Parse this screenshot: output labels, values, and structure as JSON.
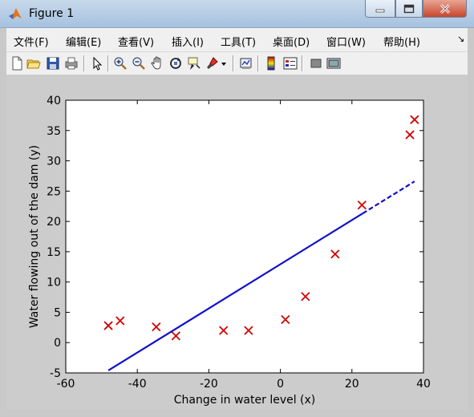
{
  "window": {
    "title": "Figure 1"
  },
  "menu": [
    "文件(F)",
    "编辑(E)",
    "查看(V)",
    "插入(I)",
    "工具(T)",
    "桌面(D)",
    "窗口(W)",
    "帮助(H)"
  ],
  "toolbar": [
    "new-figure",
    "open-file",
    "save",
    "print",
    "pointer",
    "zoom-in",
    "zoom-out",
    "pan",
    "rotate-3d",
    "data-cursor",
    "brush",
    "link",
    "insert-colorbar",
    "insert-legend",
    "hide-plot-tools",
    "show-plot-tools"
  ],
  "chart_data": {
    "type": "scatter",
    "xlabel": "Change in water level (x)",
    "ylabel": "Water flowing out of the dam (y)",
    "xlim": [
      -60,
      40
    ],
    "ylim": [
      -5,
      40
    ],
    "xticks": [
      "-60",
      "-40",
      "-20",
      "0",
      "20",
      "40"
    ],
    "yticks": [
      "-5",
      "0",
      "5",
      "10",
      "15",
      "20",
      "25",
      "30",
      "35",
      "40"
    ],
    "grid": false,
    "points": {
      "marker": "x",
      "color": "#d40000",
      "x": [
        -48.1,
        -44.8,
        -34.7,
        -29.2,
        -15.9,
        -8.9,
        1.4,
        7.0,
        15.3,
        22.8,
        36.2,
        37.5
      ],
      "y": [
        2.8,
        3.6,
        2.6,
        1.1,
        2.0,
        2.0,
        3.8,
        7.6,
        14.6,
        22.7,
        34.3,
        36.8
      ]
    },
    "fit_line": {
      "color": "#1010cc",
      "x": [
        -48.1,
        37.5
      ],
      "y": [
        -4.6,
        26.6
      ],
      "dashed_from_x": 23
    }
  }
}
